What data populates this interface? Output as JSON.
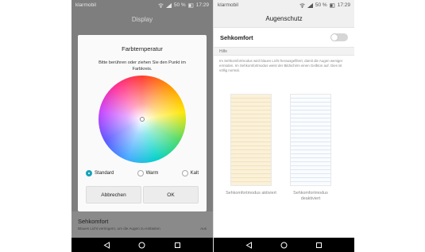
{
  "left_phone": {
    "status": {
      "carrier": "klarmobil",
      "battery": "50 %",
      "time": "17:29"
    },
    "screen_title": "Display",
    "background_item": {
      "title": "Sehkomfort",
      "subtitle": "Blaues Licht verringern, um die Augen zu entlasten",
      "value": "Aus"
    },
    "dialog": {
      "title": "Farbtemperatur",
      "instruction": "Bitte berühren oder ziehen Sie den Punkt im Farbkreis.",
      "options": [
        {
          "label": "Standard",
          "selected": true
        },
        {
          "label": "Warm",
          "selected": false
        },
        {
          "label": "Kalt",
          "selected": false
        }
      ],
      "cancel_label": "Abbrechen",
      "ok_label": "OK"
    }
  },
  "right_phone": {
    "status": {
      "carrier": "klarmobil",
      "battery": "50 %",
      "time": "17:29"
    },
    "screen_title": "Augenschutz",
    "toggle_label": "Sehkomfort",
    "toggle_on": false,
    "help_header": "Hilfe",
    "help_text": "Im Sehkomfortmodus wird blaues Licht herausgefiltert, damit die Augen weniger ermüden. Im Sehkomfortmodus weist der Bildschirm einen Gelbton auf. Dies ist völlig normal.",
    "preview_on_caption": "Sehkomfortmodus aktiviert",
    "preview_off_caption": "Sehkomfortmodus deaktiviert"
  },
  "colors": {
    "accent": "#17a2b8",
    "dim_overlay": "#7e7e7e",
    "navbar": "#000000"
  },
  "icons": [
    "wifi-icon",
    "signal-icon",
    "battery-icon",
    "back-icon",
    "home-icon",
    "recents-icon",
    "color-wheel-handle-icon"
  ]
}
